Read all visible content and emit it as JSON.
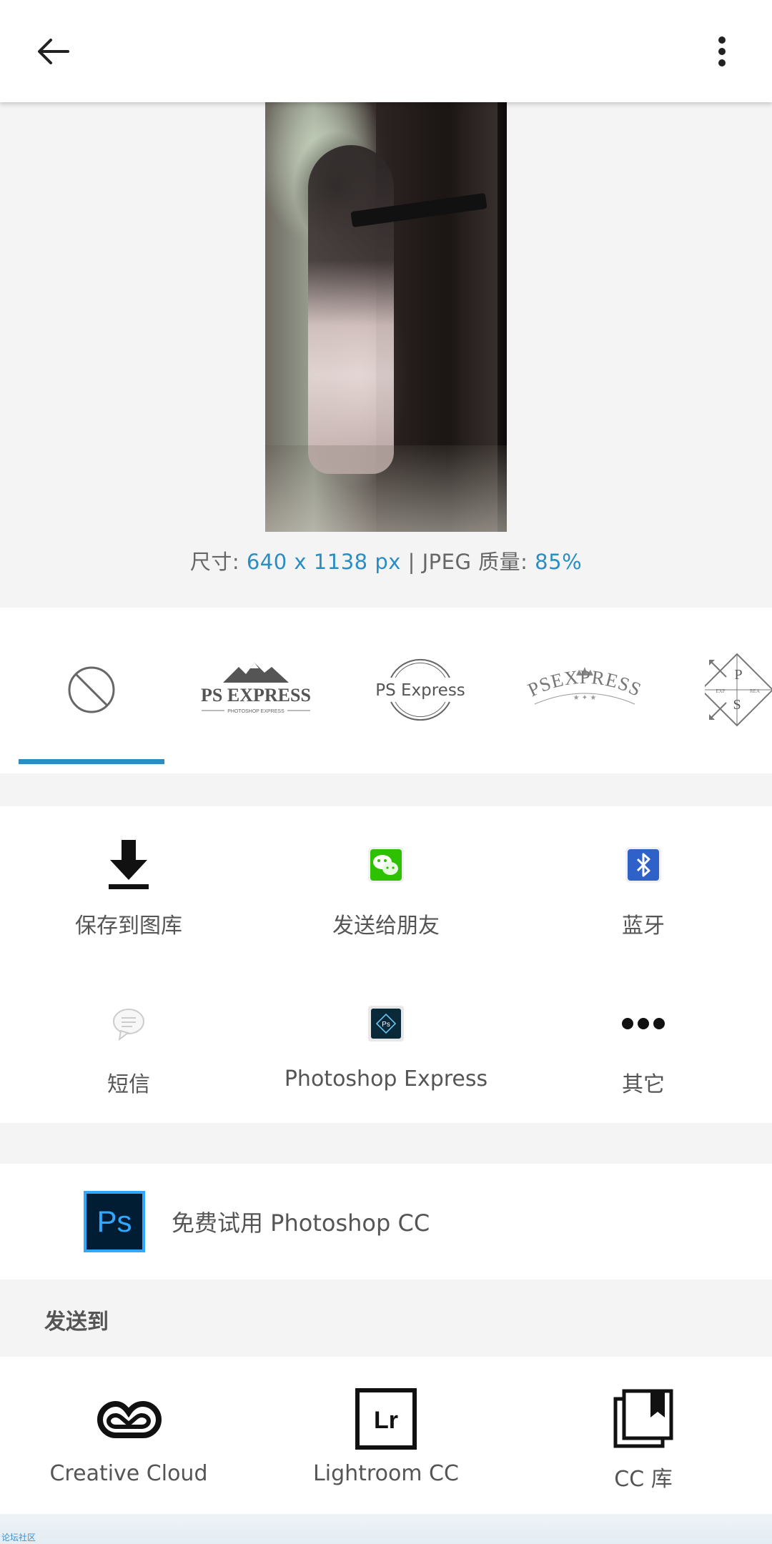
{
  "appbar": {
    "back_icon": "arrow-left-icon",
    "more_icon": "more-vertical-icon"
  },
  "image_info": {
    "size_label": "尺寸:",
    "size_value": "640 x 1138 px",
    "separator": "|",
    "quality_label": "JPEG 质量:",
    "quality_value": "85%"
  },
  "watermarks": {
    "selected_index": 0,
    "items": [
      {
        "name": "none",
        "icon": "no-watermark-icon"
      },
      {
        "name": "ps-express-mountain",
        "title": "PS EXPRESS",
        "subtitle": "PHOTOSHOP EXPRESS"
      },
      {
        "name": "ps-express-circle",
        "title": "PS Express"
      },
      {
        "name": "psexpress-crown",
        "title": "PSEXPRESS"
      },
      {
        "name": "ps-diamond",
        "letters": [
          "P",
          "S"
        ],
        "side_left": "EXP",
        "side_right": "REA"
      }
    ]
  },
  "actions": [
    {
      "label": "保存到图库",
      "icon": "download-icon"
    },
    {
      "label": "发送给朋友",
      "icon": "wechat-icon"
    },
    {
      "label": "蓝牙",
      "icon": "bluetooth-icon"
    },
    {
      "label": "短信",
      "icon": "message-icon"
    },
    {
      "label": "Photoshop Express",
      "icon": "ps-express-icon",
      "icon_text": "Ps"
    },
    {
      "label": "其它",
      "icon": "more-horizontal-icon"
    }
  ],
  "trial": {
    "icon_text": "Ps",
    "label": "免费试用 Photoshop CC"
  },
  "send_to": {
    "header": "发送到",
    "items": [
      {
        "label": "Creative Cloud",
        "icon": "creative-cloud-icon"
      },
      {
        "label": "Lightroom CC",
        "icon": "lightroom-icon",
        "icon_text": "Lr"
      },
      {
        "label": "CC 库",
        "icon": "cc-libraries-icon"
      }
    ]
  },
  "bottom_tag": "论坛社区",
  "colors": {
    "accent": "#2a8ec2",
    "wechat": "#2dc100",
    "bluetooth": "#2f62c9",
    "ps_blue": "#31a8ff",
    "ps_dark": "#001d34"
  }
}
